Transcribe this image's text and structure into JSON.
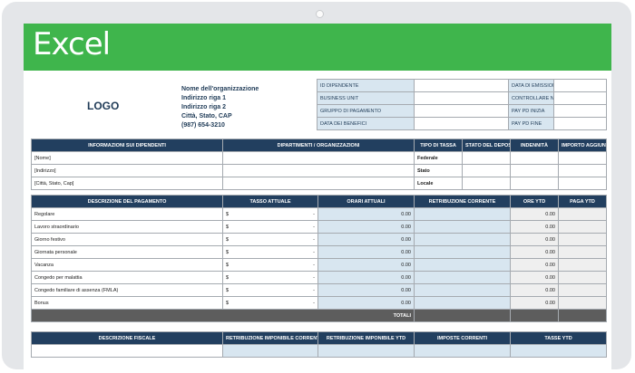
{
  "app_title": "Excel",
  "logo": "LOGO",
  "org": {
    "name": "Nome dell'organizzazione",
    "address1": "Indirizzo riga 1",
    "address2": "Indirizzo riga 2",
    "city": "Città, Stato, CAP",
    "phone": "(987) 654-3210"
  },
  "info_box": {
    "rows": [
      {
        "label": "ID DIPENDENTE",
        "value": "",
        "label2": "DATA DI EMISSIONE",
        "value2": ""
      },
      {
        "label": "BUSINESS UNIT",
        "value": "",
        "label2": "CONTROLLARE NO.",
        "value2": ""
      },
      {
        "label": "GRUPPO DI PAGAMENTO",
        "value": "",
        "label2": "PAY PD INIZIA",
        "value2": ""
      },
      {
        "label": "DATA DEI BENEFICI",
        "value": "",
        "label2": "PAY PD FINE",
        "value2": ""
      }
    ]
  },
  "employee_table": {
    "headers": [
      "INFORMAZIONI SUI DIPENDENTI",
      "DIPARTIMENTI / ORGANIZZAZIONI",
      "TIPO DI TASSA",
      "STATO DEL DEPOSITO",
      "INDENNITÀ",
      "IMPORTO AGGIUNTIVO"
    ],
    "rows": [
      {
        "info": "[Nome]",
        "tax": "Federale"
      },
      {
        "info": "[Indirizzo]",
        "tax": "Stato"
      },
      {
        "info": "[Città, Stato, Cap]",
        "tax": "Locale"
      }
    ]
  },
  "payment_table": {
    "headers": [
      "DESCRIZIONE DEL PAGAMENTO",
      "TASSO ATTUALE",
      "ORARI ATTUALI",
      "RETRIBUZIONE CORRENTE",
      "ORE YTD",
      "PAGA YTD"
    ],
    "currency": "$",
    "dash": "-",
    "rows": [
      {
        "desc": "Regolare",
        "hours": "0.00",
        "ytd_hours": "0.00"
      },
      {
        "desc": "Lavoro straordinario",
        "hours": "0.00",
        "ytd_hours": "0.00"
      },
      {
        "desc": "Giorno festivo",
        "hours": "0.00",
        "ytd_hours": "0.00"
      },
      {
        "desc": "Giornata personale",
        "hours": "0.00",
        "ytd_hours": "0.00"
      },
      {
        "desc": "Vacanza",
        "hours": "0.00",
        "ytd_hours": "0.00"
      },
      {
        "desc": "Congedo per malattia",
        "hours": "0.00",
        "ytd_hours": "0.00"
      },
      {
        "desc": "Congedo familiare di assenza (FMLA)",
        "hours": "0.00",
        "ytd_hours": "0.00"
      },
      {
        "desc": "Bonus",
        "hours": "0.00",
        "ytd_hours": "0.00"
      }
    ],
    "totals_label": "TOTALI"
  },
  "tax_table": {
    "headers": [
      "DESCRIZIONE FISCALE",
      "RETRIBUZIONE IMPONIBILE CORRENTE",
      "RETRIBUZIONE IMPONIBILE YTD",
      "IMPOSTE CORRENTI",
      "TASSE YTD"
    ]
  }
}
